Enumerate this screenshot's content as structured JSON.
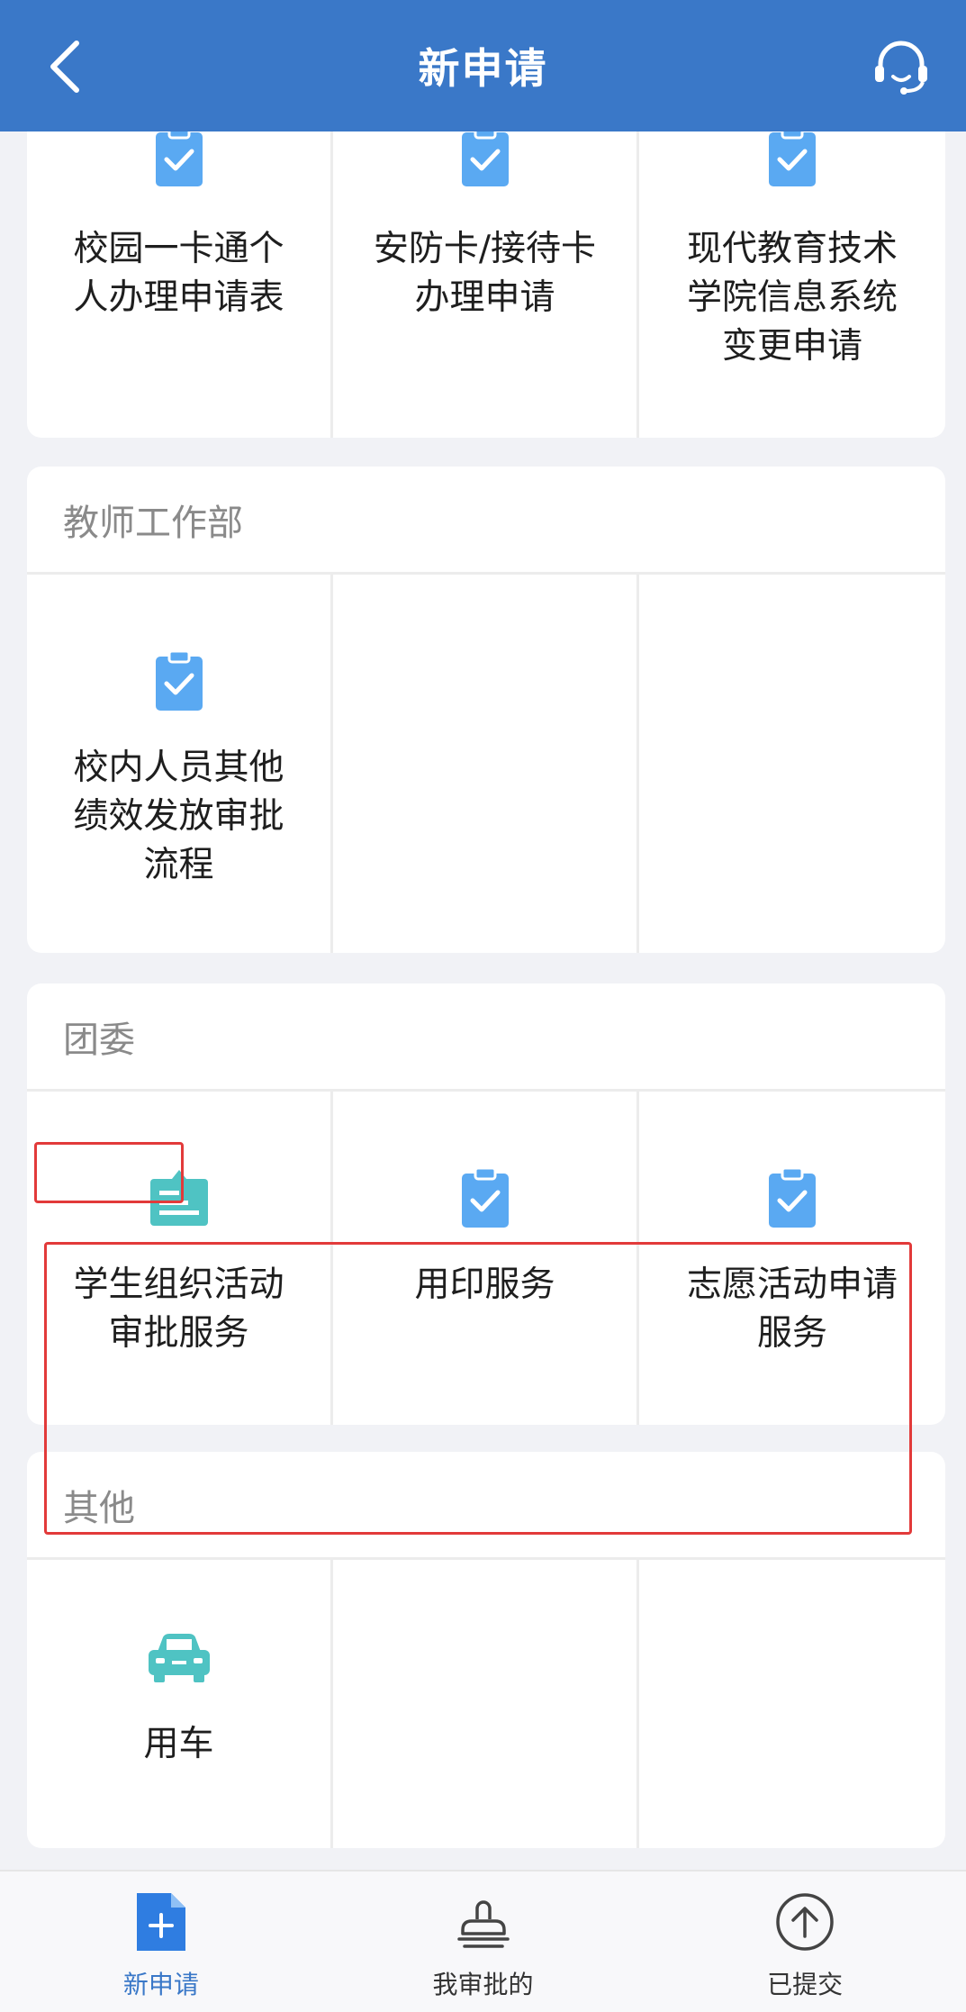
{
  "header": {
    "title": "新申请"
  },
  "top_section": {
    "items": [
      {
        "label": "校园一卡通个人办理申请表",
        "icon": "clipboard-check-icon"
      },
      {
        "label": "安防卡/接待卡办理申请",
        "icon": "clipboard-check-icon"
      },
      {
        "label": "现代教育技术学院信息系统变更申请",
        "icon": "clipboard-check-icon"
      }
    ]
  },
  "sections": [
    {
      "title": "教师工作部",
      "items": [
        {
          "label": "校内人员其他绩效发放审批流程",
          "icon": "clipboard-check-icon"
        }
      ]
    },
    {
      "title": "团委",
      "items": [
        {
          "label": "学生组织活动审批服务",
          "icon": "clipboard-list-icon"
        },
        {
          "label": "用印服务",
          "icon": "clipboard-check-icon"
        },
        {
          "label": "志愿活动申请服务",
          "icon": "clipboard-check-icon"
        }
      ]
    },
    {
      "title": "其他",
      "items": [
        {
          "label": "用车",
          "icon": "car-icon"
        }
      ]
    }
  ],
  "tabbar": {
    "tabs": [
      {
        "label": "新申请",
        "icon": "new-document-icon",
        "active": true
      },
      {
        "label": "我审批的",
        "icon": "stamp-icon",
        "active": false
      },
      {
        "label": "已提交",
        "icon": "upload-circle-icon",
        "active": false
      }
    ]
  },
  "colors": {
    "header": "#3a78c8",
    "icon_blue": "#5aa9f2",
    "icon_teal": "#4fc3c3",
    "highlight": "#e23a3a"
  }
}
